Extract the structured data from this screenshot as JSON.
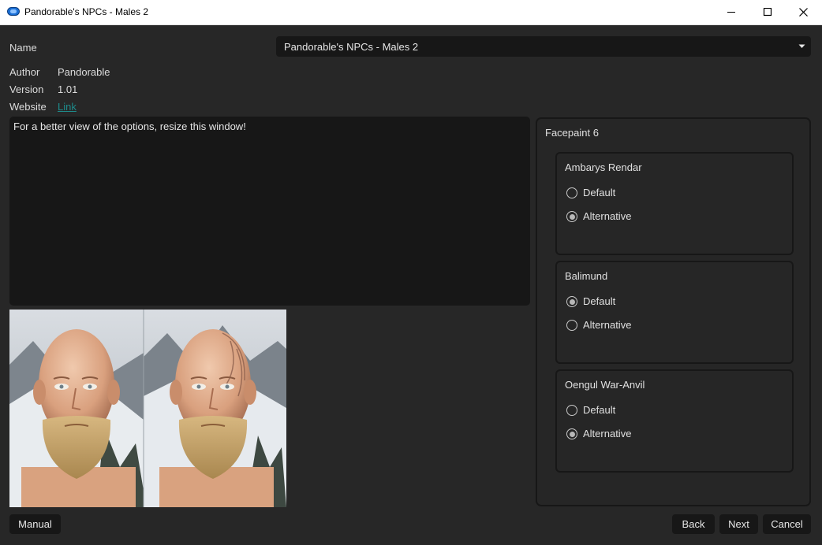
{
  "window": {
    "title": "Pandorable's NPCs - Males 2",
    "controls": [
      "minimize",
      "maximize",
      "close"
    ]
  },
  "info": {
    "name_label": "Name",
    "name_value": "Pandorable's NPCs - Males 2",
    "author_label": "Author",
    "author_value": "Pandorable",
    "version_label": "Version",
    "version_value": "1.01",
    "website_label": "Website",
    "website_value": "Link"
  },
  "description": "For a better view of the options, resize this window!",
  "group": {
    "title": "Facepaint 6",
    "subgroups": [
      {
        "title": "Ambarys Rendar",
        "options": [
          {
            "label": "Default",
            "selected": false
          },
          {
            "label": "Alternative",
            "selected": true
          }
        ]
      },
      {
        "title": "Balimund",
        "options": [
          {
            "label": "Default",
            "selected": true
          },
          {
            "label": "Alternative",
            "selected": false
          }
        ]
      },
      {
        "title": "Oengul War-Anvil",
        "options": [
          {
            "label": "Default",
            "selected": false
          },
          {
            "label": "Alternative",
            "selected": true
          }
        ]
      }
    ]
  },
  "buttons": {
    "manual": "Manual",
    "back": "Back",
    "next": "Next",
    "cancel": "Cancel"
  },
  "colors": {
    "background": "#272727",
    "field": "#171717",
    "link": "#1e8a8a",
    "titlebar": "#ffffff"
  }
}
